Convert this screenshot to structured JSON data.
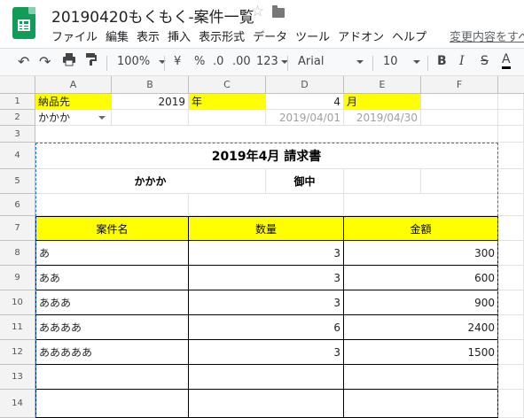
{
  "app": {
    "doc_title": "20190420もくもく-案件一覧",
    "last_edit": "変更内容をすべ"
  },
  "menu": [
    "ファイル",
    "編集",
    "表示",
    "挿入",
    "表示形式",
    "データ",
    "ツール",
    "アドオン",
    "ヘルプ"
  ],
  "toolbar": {
    "zoom": "100%",
    "currency": "¥",
    "percent": "%",
    "dec_less": ".0",
    "dec_more": ".00",
    "format_123": "123",
    "font": "Arial",
    "font_size": "10",
    "bold": "B",
    "italic": "I",
    "strike": "S",
    "text_color": "A"
  },
  "columns": [
    "A",
    "B",
    "C",
    "D",
    "E",
    "F"
  ],
  "rows": [
    "1",
    "2",
    "3",
    "4",
    "5",
    "6",
    "7",
    "8",
    "9",
    "10",
    "11",
    "12",
    "13",
    "14"
  ],
  "sheet": {
    "r1": {
      "a": "納品先",
      "b": "2019",
      "c": "年",
      "d": "4",
      "e": "月"
    },
    "r2": {
      "a": "かかか",
      "d": "2019/04/01",
      "e": "2019/04/30"
    },
    "invoice_title": "2019年4月 請求書",
    "client": "かかか",
    "honorific": "御中",
    "headers": {
      "name": "案件名",
      "qty": "数量",
      "amount": "金額"
    },
    "items": [
      {
        "name": "あ",
        "qty": "3",
        "amount": "300"
      },
      {
        "name": "ああ",
        "qty": "3",
        "amount": "600"
      },
      {
        "name": "あああ",
        "qty": "3",
        "amount": "900"
      },
      {
        "name": "ああああ",
        "qty": "6",
        "amount": "2400"
      },
      {
        "name": "あああああ",
        "qty": "3",
        "amount": "1500"
      }
    ]
  },
  "colors": {
    "highlight": "#ffff00",
    "print_border": "#1a73e8",
    "brand": "#0f9d58"
  }
}
